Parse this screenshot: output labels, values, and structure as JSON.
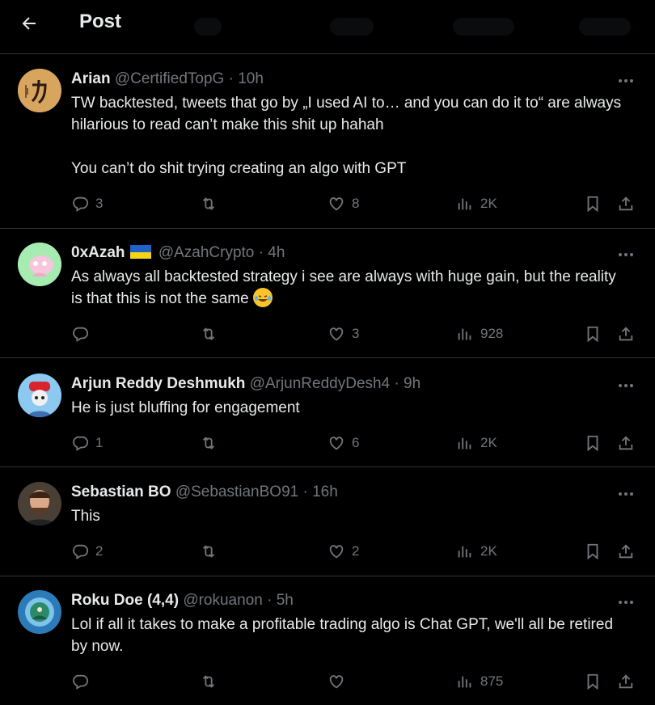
{
  "header": {
    "title": "Post"
  },
  "tweets": [
    {
      "name": "Arian",
      "handle": "@CertifiedTopG",
      "time": "10h",
      "text": "TW backtested, tweets that go by „I used AI to… and you can do it to“ are always hilarious to read can’t make this shit up hahah\n\nYou can’t do shit trying creating an algo with GPT",
      "replies": "3",
      "reposts": "",
      "likes": "8",
      "views": "2K"
    },
    {
      "name": "0xAzah",
      "handle": "@AzahCrypto",
      "time": "4h",
      "text": "As always all backtested strategy i see are always with huge gain, but the reality is that this is not the same",
      "replies": "",
      "reposts": "",
      "likes": "3",
      "views": "928"
    },
    {
      "name": "Arjun Reddy Deshmukh",
      "handle": "@ArjunReddyDesh4",
      "time": "9h",
      "text": "He is just bluffing for engagement",
      "replies": "1",
      "reposts": "",
      "likes": "6",
      "views": "2K"
    },
    {
      "name": "Sebastian BO",
      "handle": "@SebastianBO91",
      "time": "16h",
      "text": "This",
      "replies": "2",
      "reposts": "",
      "likes": "2",
      "views": "2K"
    },
    {
      "name": "Roku Doe (4,4)",
      "handle": "@rokuanon",
      "time": "5h",
      "text": "Lol if all it takes to make a profitable trading algo is Chat GPT, we'll all be retired by now.",
      "replies": "",
      "reposts": "",
      "likes": "",
      "views": "875"
    }
  ],
  "icons": {
    "back": "arrow-left-icon",
    "more": "more-icon",
    "reply": "reply-icon",
    "repost": "repost-icon",
    "like": "heart-icon",
    "views": "views-icon",
    "bookmark": "bookmark-icon",
    "share": "share-icon"
  },
  "colors": {
    "background": "#000000",
    "text": "#e7e9ea",
    "muted": "#71767b",
    "divider": "#2f3336"
  }
}
